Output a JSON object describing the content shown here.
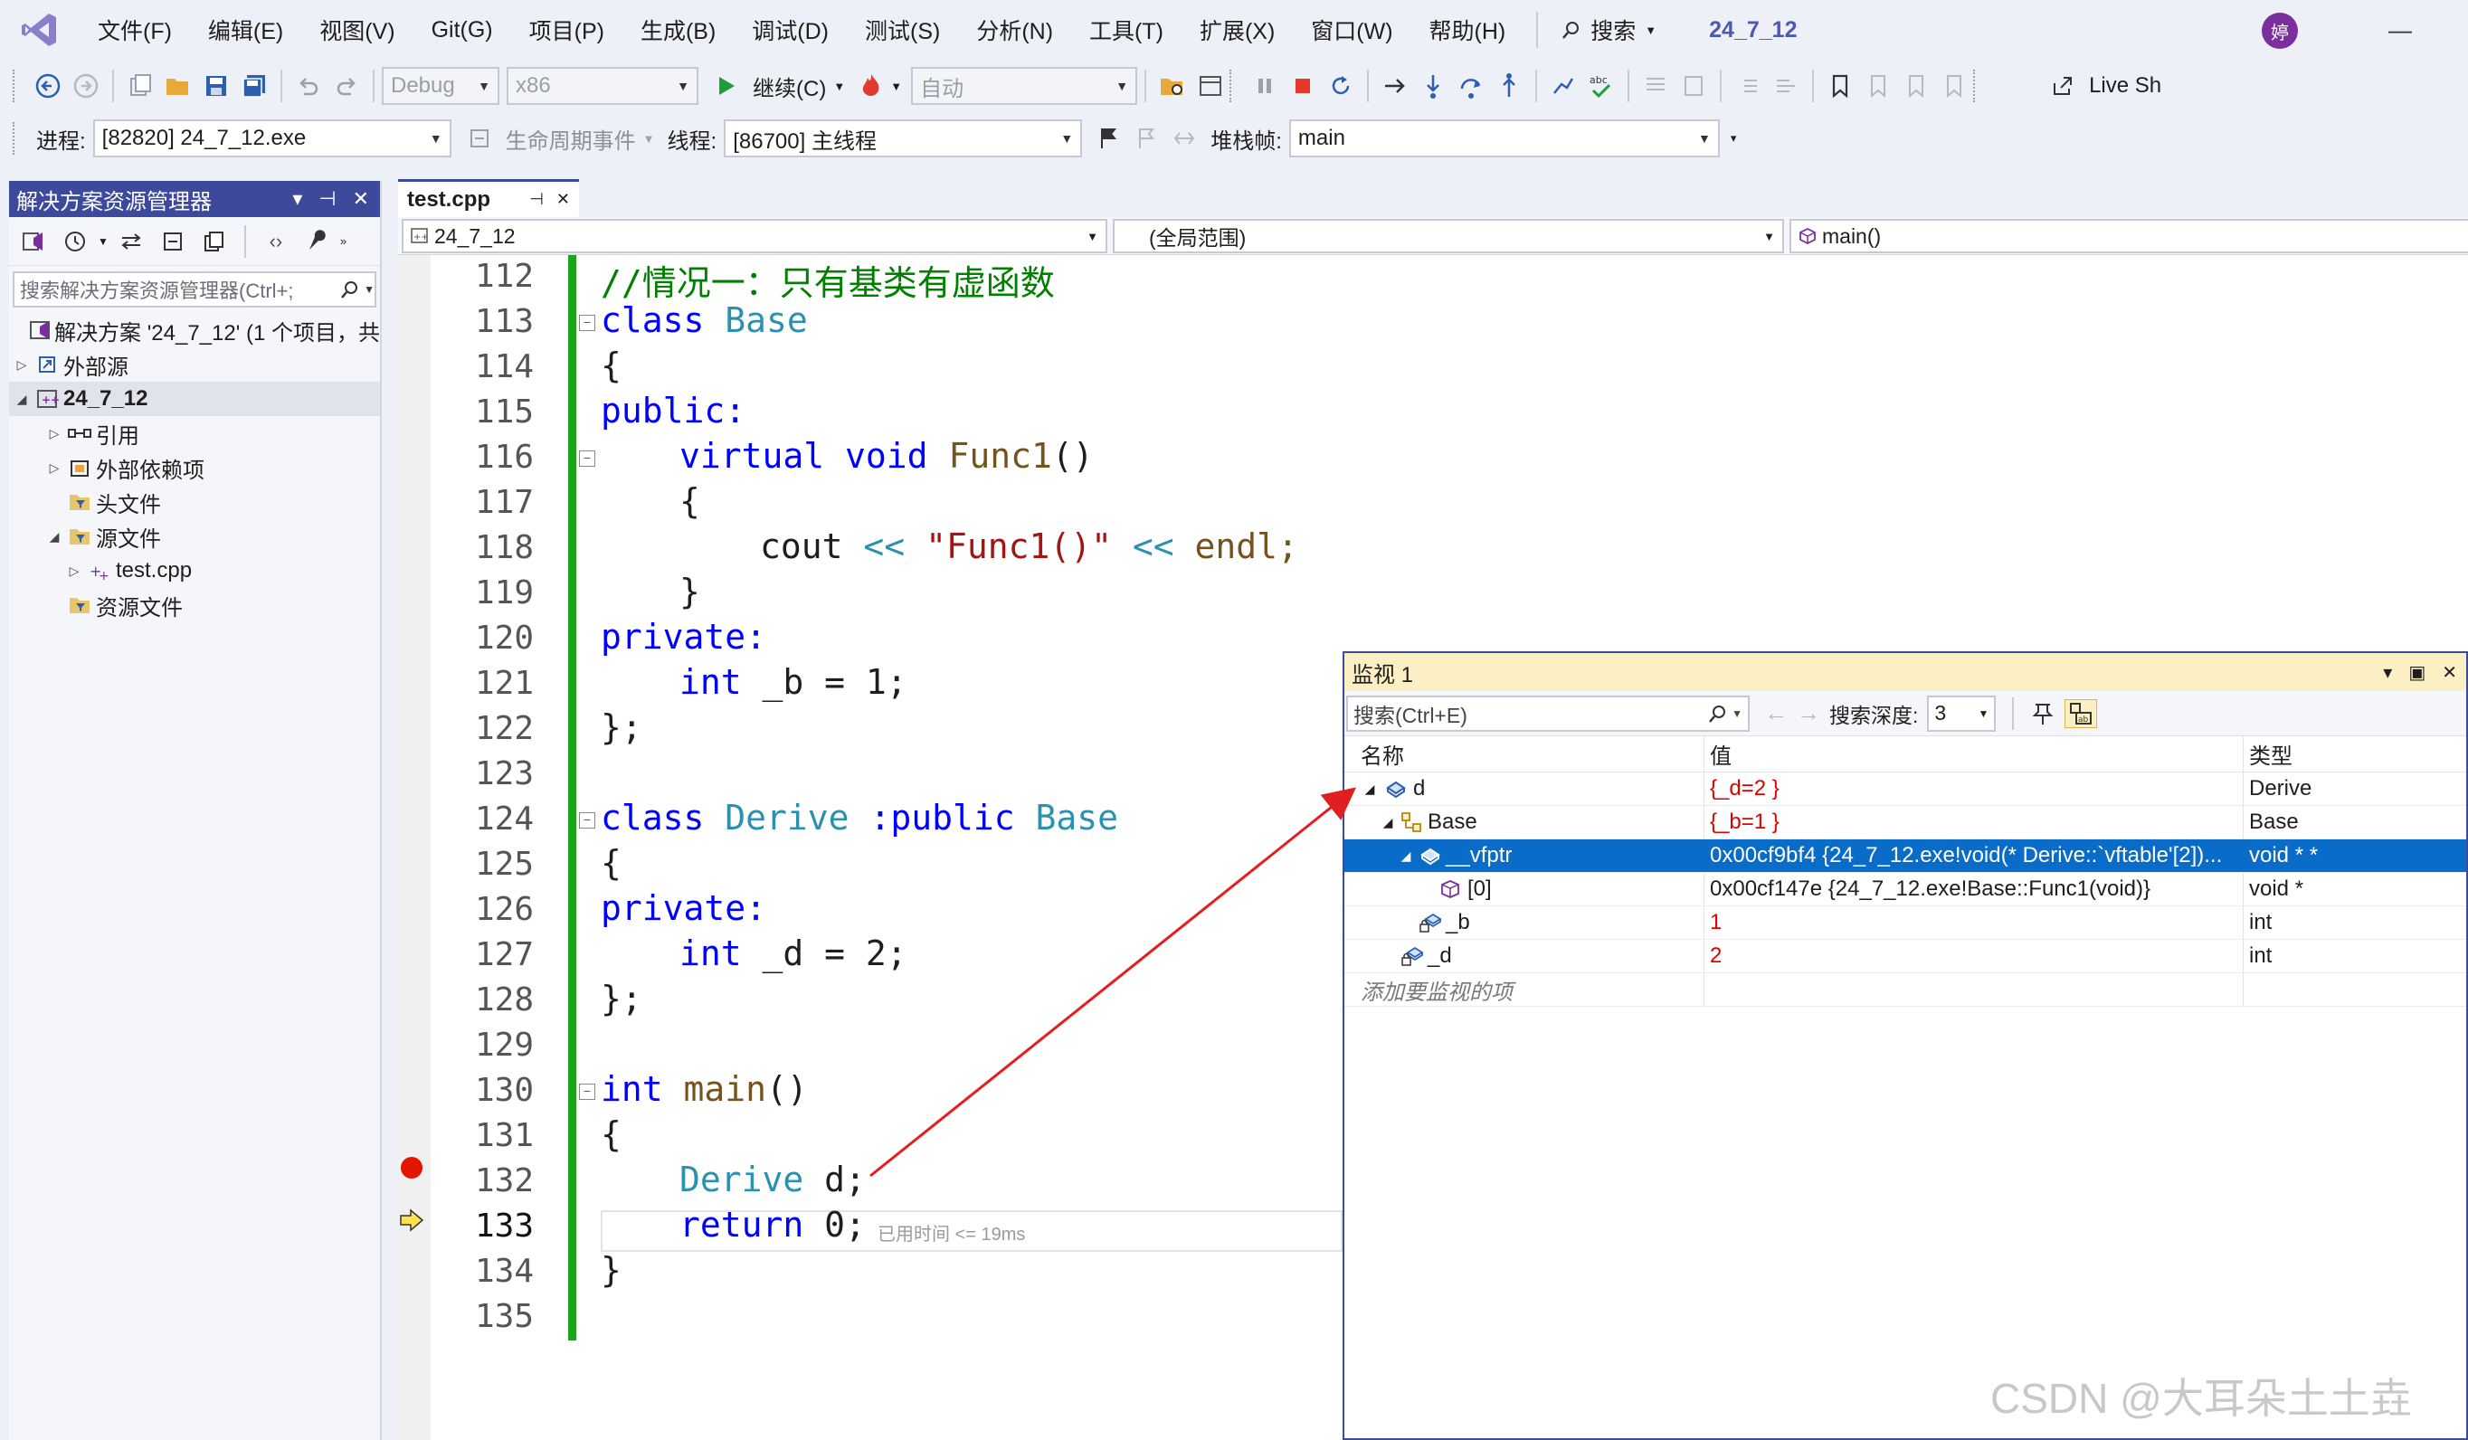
{
  "menu": {
    "items": [
      "文件(F)",
      "编辑(E)",
      "视图(V)",
      "Git(G)",
      "项目(P)",
      "生成(B)",
      "调试(D)",
      "测试(S)",
      "分析(N)",
      "工具(T)",
      "扩展(X)",
      "窗口(W)",
      "帮助(H)"
    ],
    "search_label": "搜索",
    "project_title": "24_7_12",
    "avatar_initial": "婷"
  },
  "toolbar1": {
    "config": "Debug",
    "platform": "x86",
    "continue_label": "继续(C)",
    "auto_combo": "自动",
    "live_share": "Live Sh"
  },
  "toolbar2": {
    "process_label": "进程:",
    "process_value": "[82820] 24_7_12.exe",
    "lifecycle_label": "生命周期事件",
    "thread_label": "线程:",
    "thread_value": "[86700] 主线程",
    "stackframe_label": "堆栈帧:",
    "stackframe_value": "main"
  },
  "solution_explorer": {
    "title": "解决方案资源管理器",
    "search_placeholder": "搜索解决方案资源管理器(Ctrl+;",
    "items": [
      {
        "label": "解决方案 '24_7_12' (1 个项目，共"
      },
      {
        "label": "外部源"
      },
      {
        "label": "24_7_12"
      },
      {
        "label": "引用"
      },
      {
        "label": "外部依赖项"
      },
      {
        "label": "头文件"
      },
      {
        "label": "源文件"
      },
      {
        "label": "test.cpp"
      },
      {
        "label": "资源文件"
      }
    ]
  },
  "editor": {
    "tab_name": "test.cpp",
    "nav_project": "24_7_12",
    "nav_scope": "(全局范围)",
    "nav_member": "main()",
    "line_numbers": [
      "112",
      "113",
      "114",
      "115",
      "116",
      "117",
      "118",
      "119",
      "120",
      "121",
      "122",
      "123",
      "124",
      "125",
      "126",
      "127",
      "128",
      "129",
      "130",
      "131",
      "132",
      "133",
      "134",
      "135"
    ],
    "elapsed_hint": "已用时间 <= 19ms",
    "code": {
      "l112": "//情况一：只有基类有虚函数",
      "l113_kw": "class",
      "l113_ty": "Base",
      "l114": "{",
      "l115": "public:",
      "l116_kw": "virtual void",
      "l116_fn": "Func1",
      "l117": "{",
      "l118_a": "cout",
      "l118_op": "<<",
      "l118_str": "\"Func1()\"",
      "l118_op2": "<<",
      "l118_b": "endl;",
      "l119": "}",
      "l120": "private:",
      "l121_kw": "int",
      "l121_rest": "_b = 1;",
      "l122": "};",
      "l124_kw": "class",
      "l124_ty": "Derive",
      "l124_kw2": ":public",
      "l124_ty2": "Base",
      "l125": "{",
      "l126": "private:",
      "l127_kw": "int",
      "l127_rest": "_d = 2;",
      "l128": "};",
      "l130_kw": "int",
      "l130_fn": "main",
      "l131": "{",
      "l132_ty": "Derive",
      "l132_rest": "d;",
      "l133_kw": "return",
      "l133_rest": "0;",
      "l134": "}"
    }
  },
  "watch": {
    "title": "监视 1",
    "search_placeholder": "搜索(Ctrl+E)",
    "depth_label": "搜索深度:",
    "depth_value": "3",
    "col_name": "名称",
    "col_value": "值",
    "col_type": "类型",
    "rows": [
      {
        "name": "d",
        "value": "{_d=2 }",
        "type": "Derive"
      },
      {
        "name": "Base",
        "value": "{_b=1 }",
        "type": "Base"
      },
      {
        "name": "__vfptr",
        "value": "0x00cf9bf4 {24_7_12.exe!void(* Derive::`vftable'[2])...",
        "type": "void * *"
      },
      {
        "name": "[0]",
        "value": "0x00cf147e {24_7_12.exe!Base::Func1(void)}",
        "type": "void *"
      },
      {
        "name": "_b",
        "value": "1",
        "type": "int"
      },
      {
        "name": "_d",
        "value": "2",
        "type": "int"
      }
    ],
    "add_hint": "添加要监视的项"
  },
  "watermark": "CSDN @大耳朵土土垚",
  "colors": {
    "accent": "#3d4a9c",
    "selection": "#0a6cc9",
    "keyword": "#0000ff",
    "type": "#2b91af",
    "comment": "#008000",
    "string": "#a31515",
    "breakpoint": "#e51400",
    "arrow": "#e02020"
  }
}
